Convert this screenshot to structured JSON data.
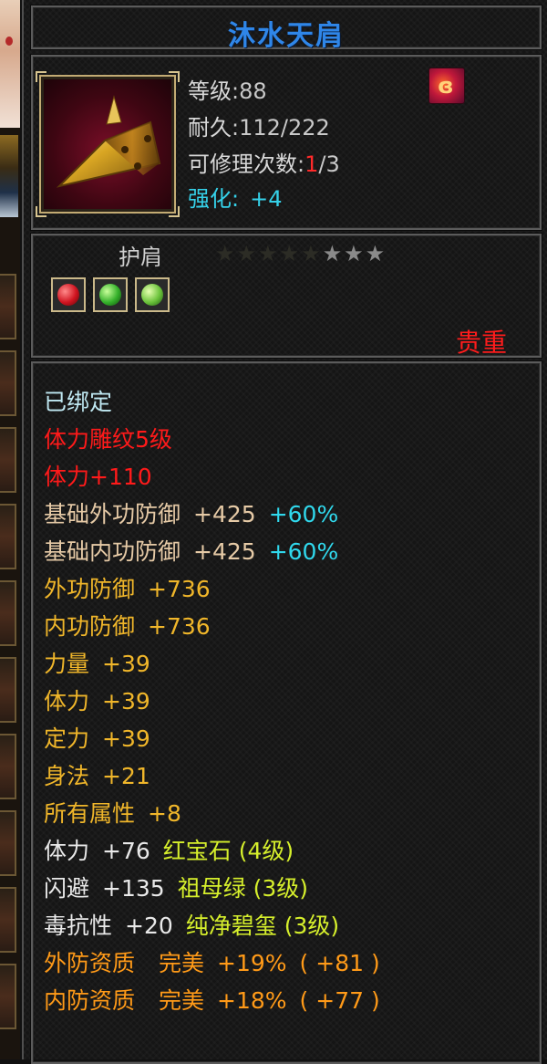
{
  "title": "沐水天肩",
  "header": {
    "level_label": "等级",
    "level_value": ":88",
    "durability_label": "耐久",
    "durability_value": ":112/222",
    "repair_label": "可修理次数",
    "repair_colon": ":",
    "repair_used": "1",
    "repair_total": "/3",
    "enhance_label": "强化:",
    "enhance_value": "+4"
  },
  "item_type": "护肩",
  "stars": {
    "dim": "★★★★★",
    "lit": "★★★"
  },
  "sockets": [
    "ruby-gem-icon",
    "emerald-gem-icon",
    "jade-gem-icon"
  ],
  "rarity": "贵重",
  "stats": {
    "bound": "已绑定",
    "engrave": "体力雕纹5级",
    "vit_bonus": "体力+110",
    "base_ext_def": {
      "label": "基础外功防御",
      "value": "+425",
      "pct": "+60%"
    },
    "base_int_def": {
      "label": "基础内功防御",
      "value": "+425",
      "pct": "+60%"
    },
    "ext_def": {
      "label": "外功防御",
      "value": "+736"
    },
    "int_def": {
      "label": "内功防御",
      "value": "+736"
    },
    "strength": {
      "label": "力量",
      "value": "+39"
    },
    "vitality": {
      "label": "体力",
      "value": "+39"
    },
    "focus": {
      "label": "定力",
      "value": "+39"
    },
    "agility": {
      "label": "身法",
      "value": "+21"
    },
    "all_attr": {
      "label": "所有属性",
      "value": "+8"
    },
    "gem1": {
      "label": "体力",
      "value": "+76",
      "gem": "红宝石 (4级)"
    },
    "gem2": {
      "label": "闪避",
      "value": "+135",
      "gem": "祖母绿 (3级)"
    },
    "gem3": {
      "label": "毒抗性",
      "value": "+20",
      "gem": "纯净碧玺 (3级)"
    },
    "ext_quality": {
      "label": "外防资质",
      "grade": "完美",
      "pct": "+19%",
      "bonus": "( +81 )"
    },
    "int_quality": {
      "label": "内防资质",
      "grade": "完美",
      "pct": "+18%",
      "bonus": "( +77 )"
    }
  },
  "colors": {
    "title": "#2f86e8",
    "rarity": "#ff1c1c",
    "bound": "#bfe8f2",
    "engrave": "#ff1a1a",
    "base_def": "#e6caa6",
    "attr": "#f0b62a",
    "gem_name": "#d6ef2c",
    "quality": "#ff9a18",
    "percent": "#30d8ec"
  }
}
